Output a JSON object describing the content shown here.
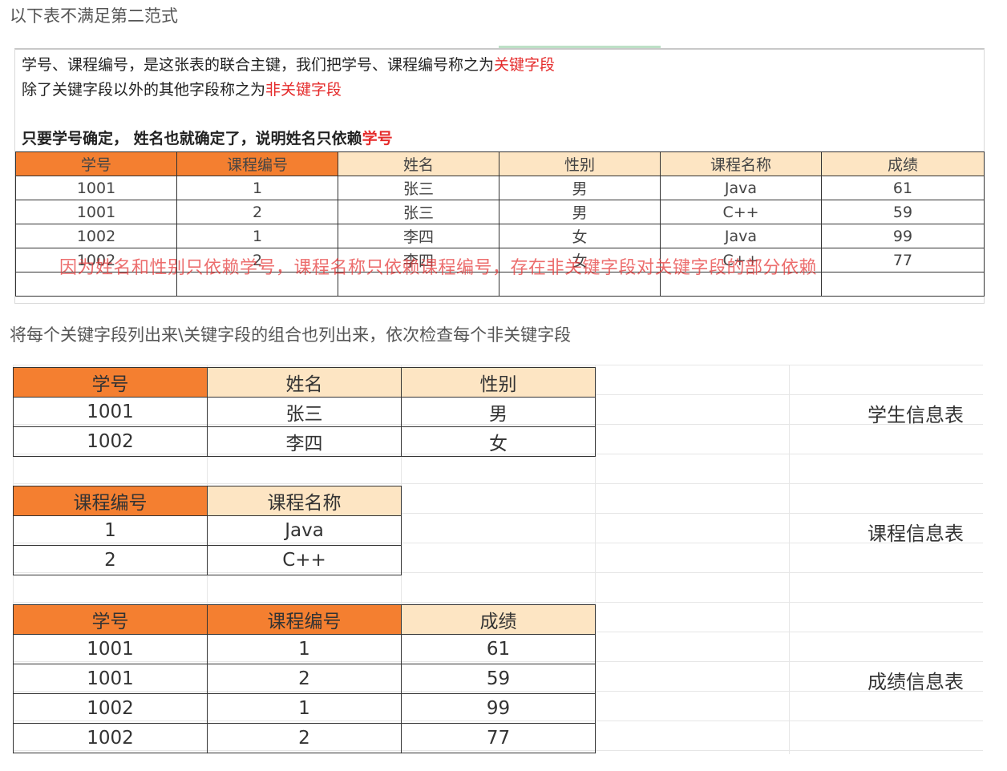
{
  "heading": "以下表不满足第二范式",
  "notes": {
    "line1_pre": "学号、课程编号，是这张表的联合主键，我们把学号、课程编号称之为",
    "line1_hl": "关键字段",
    "line2_pre": "除了关键字段以外的其他字段称之为",
    "line2_hl": "非关键字段",
    "line3_pre": "只要学号确定，  姓名也就确定了，说明姓名只依赖",
    "line3_hl": "学号"
  },
  "main_table": {
    "headers": [
      "学号",
      "课程编号",
      "姓名",
      "性别",
      "课程名称",
      "成绩"
    ],
    "rows": [
      [
        "1001",
        "1",
        "张三",
        "男",
        "Java",
        "61"
      ],
      [
        "1001",
        "2",
        "张三",
        "男",
        "C++",
        "59"
      ],
      [
        "1002",
        "1",
        "李四",
        "女",
        "Java",
        "99"
      ],
      [
        "1002",
        "2",
        "李四",
        "女",
        "C++",
        "77"
      ]
    ]
  },
  "overlay_text": "因为姓名和性别只依赖学号，课程名称只依赖课程编号，存在非关键字段对关键字段的部分依赖",
  "subheading": "将每个关键字段列出来\\关键字段的组合也列出来，依次检查每个非关键字段",
  "student_table": {
    "label": "学生信息表",
    "headers": [
      "学号",
      "姓名",
      "性别"
    ],
    "rows": [
      [
        "1001",
        "张三",
        "男"
      ],
      [
        "1002",
        "李四",
        "女"
      ]
    ]
  },
  "course_table": {
    "label": "课程信息表",
    "headers": [
      "课程编号",
      "课程名称"
    ],
    "rows": [
      [
        "1",
        "Java"
      ],
      [
        "2",
        "C++"
      ]
    ]
  },
  "score_table": {
    "label": "成绩信息表",
    "headers": [
      "学号",
      "课程编号",
      "成绩"
    ],
    "rows": [
      [
        "1001",
        "1",
        "61"
      ],
      [
        "1001",
        "2",
        "59"
      ],
      [
        "1002",
        "1",
        "99"
      ],
      [
        "1002",
        "2",
        "77"
      ]
    ]
  },
  "colors": {
    "key_header": "#f47f30",
    "nonkey_header": "#fde5c3",
    "highlight_text": "#e52b2b"
  }
}
